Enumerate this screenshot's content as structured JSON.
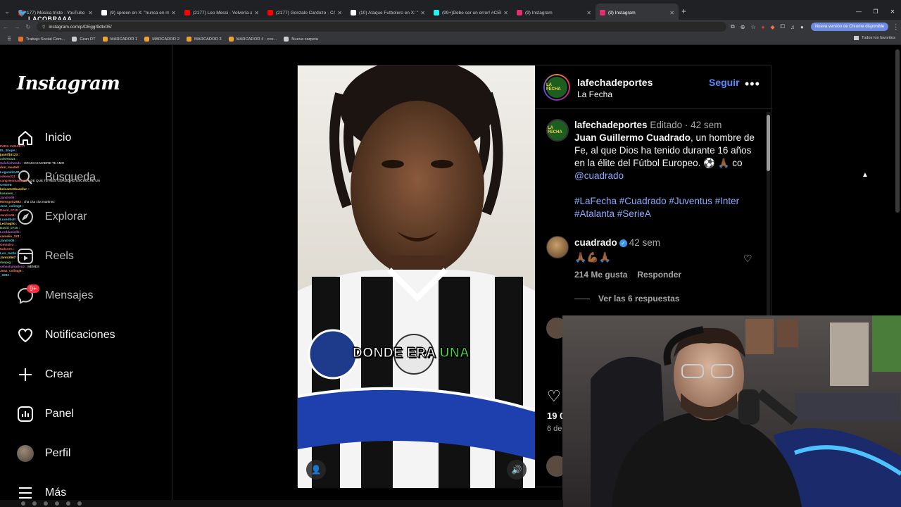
{
  "browser": {
    "tabs": [
      {
        "title": "177) Música triste - YouTube",
        "color": "#ff0000"
      },
      {
        "title": "(9) spreen en X: \"nunca en mi v",
        "color": "#ffffff"
      },
      {
        "title": "(2177) Leo Messi - Volvería a E",
        "color": "#ff0000"
      },
      {
        "title": "(2177) Gonzalo Cardozo - CAN",
        "color": "#ff0000"
      },
      {
        "title": "(10) Ataque Futbolero en X: \"🏆",
        "color": "#ffffff"
      },
      {
        "title": "(99+)Debe ser un error! #CEF",
        "color": "#25f4ee"
      },
      {
        "title": "(9) Instagram",
        "color": "#e1306c"
      },
      {
        "title": "(9) Instagram",
        "color": "#e1306c"
      }
    ],
    "url": "instagram.com/p/DEggI9dtx05/",
    "update_label": "Nueva versión de Chrome disponible",
    "bookmarks": [
      {
        "label": "Trabajo Social Com...",
        "color": "#e8712b"
      },
      {
        "label": "Gran DT",
        "color": "#cccccc"
      },
      {
        "label": "MARCADOR 1",
        "color": "#f0a030"
      },
      {
        "label": "MARCADOR 2",
        "color": "#f0a030"
      },
      {
        "label": "MARCADOR 3",
        "color": "#f0a030"
      },
      {
        "label": "MARCADOR 4 - cve...",
        "color": "#f0a030"
      },
      {
        "label": "Nueva carpeta",
        "color": "#cccccc"
      }
    ],
    "all_bookmarks": "Todos los favoritos"
  },
  "stream": {
    "logo_text": "LACOBRAAA",
    "chat": [
      {
        "u": "PARA JUGAR??",
        "m": ""
      },
      {
        "u": "EL_ElopA :",
        "m": ""
      },
      {
        "u": "juanif16123 :",
        "m": ""
      },
      {
        "u": "xdsiex321 :",
        "m": ""
      },
      {
        "u": "Salchichonds :",
        "m": "GRACIAS MADRE TE AMO"
      },
      {
        "u": "don_mastell :",
        "m": ""
      },
      {
        "u": "Logandito40 :",
        "m": ""
      },
      {
        "u": "xdsiex321 :",
        "m": ""
      },
      {
        "u": "cangrejomaster12 :",
        "m": "DE QUE TE REIS GORDO NO ESCHUCHE UN"
      },
      {
        "u": "CHISTE",
        "m": ""
      },
      {
        "u": "belcanteSkareller :",
        "m": ""
      },
      {
        "u": "kasanes_ :",
        "m": ""
      },
      {
        "u": "Jandro05 :",
        "m": ""
      },
      {
        "u": "Morogon2883 :",
        "m": "cha cha cha martinez"
      },
      {
        "u": "Jean_colimg9 :",
        "m": ""
      },
      {
        "u": "David_0710 :",
        "m": ""
      },
      {
        "u": "Jandro05 :",
        "m": ""
      },
      {
        "u": "Luxedbult :",
        "m": ""
      },
      {
        "u": "Lechuglio :",
        "m": ""
      },
      {
        "u": "David_0710 :",
        "m": ""
      },
      {
        "u": "Lorddaniellb :",
        "m": ""
      },
      {
        "u": "camelio_123 :",
        "m": ""
      },
      {
        "u": "Jandro05 :",
        "m": ""
      },
      {
        "u": "Omnidro :",
        "m": ""
      },
      {
        "u": "tadu17n :",
        "m": ""
      },
      {
        "u": "Leo_rastle :",
        "m": ""
      },
      {
        "u": "Jantoz567 :",
        "m": ""
      },
      {
        "u": "danpig :",
        "m": ""
      },
      {
        "u": "sebastianprlso2 :",
        "m": "MEMES"
      },
      {
        "u": "Jean_colimg9 :",
        "m": ""
      },
      {
        "u": "_9283 :",
        "m": ""
      }
    ]
  },
  "sidebar": {
    "logo": "Instagram",
    "items": [
      {
        "label": "Inicio"
      },
      {
        "label": "Búsqueda"
      },
      {
        "label": "Explorar"
      },
      {
        "label": "Reels"
      },
      {
        "label": "Mensajes",
        "badge": "9+"
      },
      {
        "label": "Notificaciones"
      },
      {
        "label": "Crear"
      },
      {
        "label": "Panel"
      },
      {
        "label": "Perfil"
      },
      {
        "label": "Más"
      }
    ]
  },
  "post": {
    "logo_text": "LA FECHA",
    "username": "lafechadeportes",
    "subtitle": "La Fecha",
    "follow": "Seguir",
    "more": "•••",
    "overlay_text": "DONDE ERA",
    "overlay_highlight": "UNA",
    "caption": {
      "user": "lafechadeportes",
      "edited": "Editado",
      "dot": "·",
      "time": "42 sem",
      "bold": "Juan Guillermo Cuadrado",
      "text": ", un hombre de Fe, al que Dios ha tenido durante 16 años en la élite del Fútbol Europeo. ⚽ 🙏🏾 co ",
      "mention": "@cuadrado",
      "tags": "#LaFecha #Cuadrado #Juventus #Inter #Atalanta #SerieA"
    },
    "comment": {
      "user": "cuadrado",
      "time": "42 sem",
      "text": "🙏🏾💪🏾🙏🏾",
      "likes": "214 Me gusta",
      "reply": "Responder",
      "view_replies": "Ver las 6 respuestas"
    },
    "likes_partial": "19 0",
    "date_partial": "6 de"
  }
}
